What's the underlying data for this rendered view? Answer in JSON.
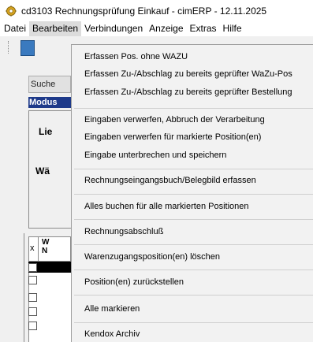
{
  "window": {
    "title": "cd3103 Rechnungsprüfung Einkauf - cimERP - 12.11.2025",
    "icon": "gear-icon"
  },
  "menubar": {
    "items": [
      "Datei",
      "Bearbeiten",
      "Verbindungen",
      "Anzeige",
      "Extras",
      "Hilfe"
    ]
  },
  "background": {
    "search_button": "Suche",
    "modus_label": "Modus",
    "lie_label": "Lie",
    "wae_label": "Wä",
    "grid_x": "x",
    "grid_col": "W\nN"
  },
  "context_menu": {
    "items": [
      "Erfassen Pos. ohne WAZU",
      "Erfassen Zu-/Abschlag zu bereits geprüfter WaZu-Pos",
      "Erfassen Zu-/Abschlag zu bereits geprüfter Bestellung",
      "Eingaben verwerfen, Abbruch der Verarbeitung",
      "Eingaben verwerfen für markierte Position(en)",
      "Eingabe unterbrechen und speichern",
      "Rechnungseingangsbuch/Belegbild erfassen",
      "Alles buchen für alle markierten Positionen",
      "Rechnungsabschluß",
      "Warenzugangsposition(en) löschen",
      "Position(en) zurückstellen",
      "Alle markieren",
      "Kendox Archiv"
    ]
  }
}
